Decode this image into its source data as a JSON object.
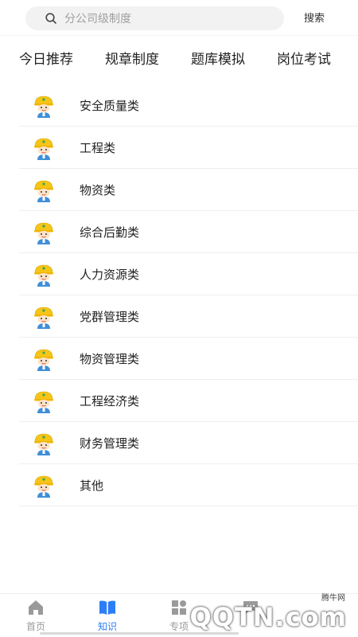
{
  "search": {
    "placeholder": "分公司级制度",
    "button_label": "搜索"
  },
  "tabs": [
    {
      "label": "今日推荐"
    },
    {
      "label": "规章制度"
    },
    {
      "label": "题库模拟"
    },
    {
      "label": "岗位考试"
    }
  ],
  "categories": [
    {
      "label": "安全质量类"
    },
    {
      "label": "工程类"
    },
    {
      "label": "物资类"
    },
    {
      "label": "综合后勤类"
    },
    {
      "label": "人力资源类"
    },
    {
      "label": "党群管理类"
    },
    {
      "label": "物资管理类"
    },
    {
      "label": "工程经济类"
    },
    {
      "label": "财务管理类"
    },
    {
      "label": "其他"
    }
  ],
  "bottom_nav": [
    {
      "label": "首页",
      "icon": "home-icon"
    },
    {
      "label": "知识",
      "icon": "book-icon",
      "active": true
    },
    {
      "label": "专项",
      "icon": "grid-icon"
    },
    {
      "label": "",
      "icon": "chat-icon"
    }
  ],
  "watermark": {
    "top_text": "腾牛网",
    "main_text": "QQTN.com"
  },
  "colors": {
    "accent": "#2d7df6",
    "helmet": "#f5c518",
    "inactive_nav": "#9a9a9a"
  }
}
